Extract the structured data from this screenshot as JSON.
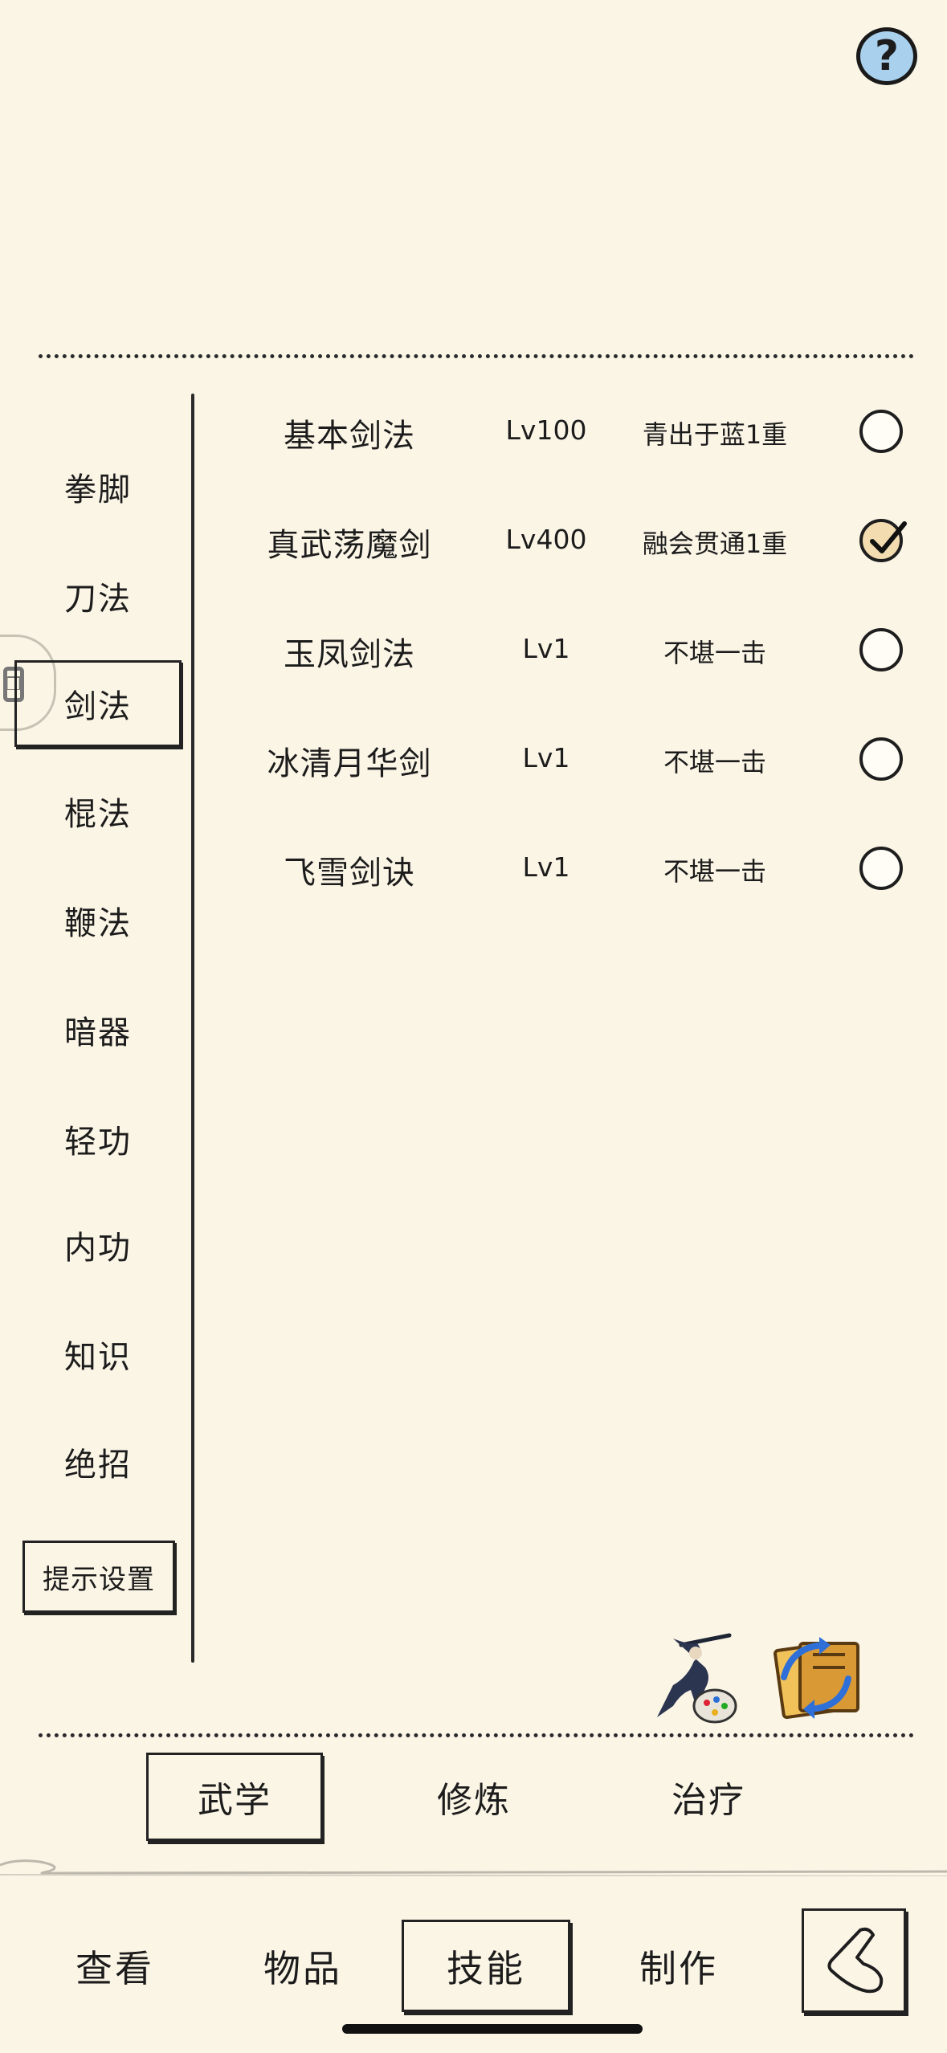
{
  "help": {
    "label": "?"
  },
  "sidebar": {
    "items": [
      {
        "label": "拳脚",
        "active": false
      },
      {
        "label": "刀法",
        "active": false
      },
      {
        "label": "剑法",
        "active": true
      },
      {
        "label": "棍法",
        "active": false
      },
      {
        "label": "鞭法",
        "active": false
      },
      {
        "label": "暗器",
        "active": false
      },
      {
        "label": "轻功",
        "active": false
      },
      {
        "label": "内功",
        "active": false
      },
      {
        "label": "知识",
        "active": false
      },
      {
        "label": "绝招",
        "active": false
      }
    ],
    "hint_button": "提示设置"
  },
  "skills": [
    {
      "name": "基本剑法",
      "level": "Lv100",
      "state": "青出于蓝1重",
      "checked": false
    },
    {
      "name": "真武荡魔剑",
      "level": "Lv400",
      "state": "融会贯通1重",
      "checked": true
    },
    {
      "name": "玉凤剑法",
      "level": "Lv1",
      "state": "不堪一击",
      "checked": false
    },
    {
      "name": "冰清月华剑",
      "level": "Lv1",
      "state": "不堪一击",
      "checked": false
    },
    {
      "name": "飞雪剑诀",
      "level": "Lv1",
      "state": "不堪一击",
      "checked": false
    }
  ],
  "decor_icons": [
    "swordsman-painting-icon",
    "book-swap-icon"
  ],
  "subtabs": [
    {
      "label": "武学",
      "active": true
    },
    {
      "label": "修炼",
      "active": false
    },
    {
      "label": "治疗",
      "active": false
    }
  ],
  "nav": {
    "items": [
      {
        "label": "查看",
        "active": false
      },
      {
        "label": "物品",
        "active": false
      },
      {
        "label": "技能",
        "active": true
      },
      {
        "label": "制作",
        "active": false
      }
    ],
    "back_icon": "back-arrow-icon"
  },
  "colors": {
    "background": "#fbf5e6",
    "ink": "#1c1c1c",
    "help_fill": "#a9d0ec",
    "checked_fill": "#f3ddb0"
  }
}
